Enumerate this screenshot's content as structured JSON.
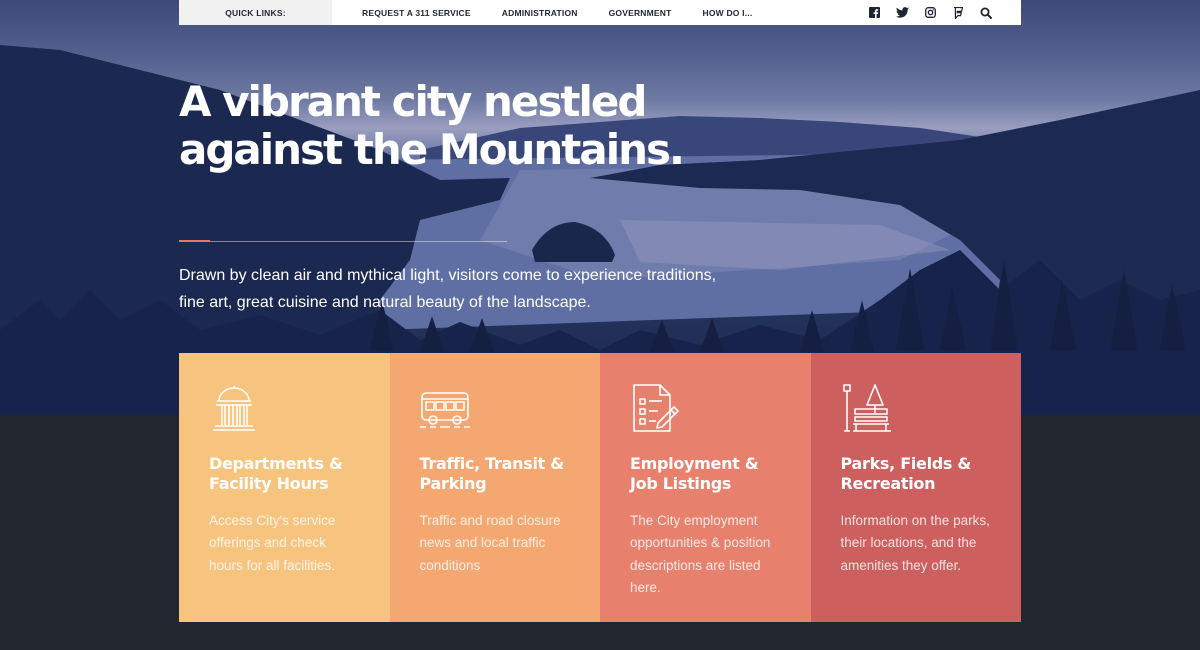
{
  "nav": {
    "quick_links_label": "QUICK LINKS:",
    "links": [
      "REQUEST A 311 SERVICE",
      "ADMINISTRATION",
      "GOVERNMENT",
      "HOW DO I..."
    ],
    "social_icons": [
      "facebook-icon",
      "twitter-icon",
      "instagram-icon",
      "foursquare-icon",
      "search-icon"
    ]
  },
  "hero": {
    "headline": "A vibrant city nestled against the Mountains.",
    "intro": "Drawn by clean air and mythical light, visitors come to experience traditions, fine art, great cuisine and natural beauty of the landscape.",
    "accent_color": "#e9765e"
  },
  "cards": [
    {
      "icon": "courthouse-icon",
      "title": "Departments & Facility Hours",
      "description": "Access City's service offerings and check hours for all facilities.",
      "color": "#f7c47f"
    },
    {
      "icon": "bus-icon",
      "title": "Traffic, Transit & Parking",
      "description": "Traffic and road closure news and local traffic conditions",
      "color": "#f4a770"
    },
    {
      "icon": "document-icon",
      "title": "Employment & Job Listings",
      "description": "The City employment opportunities & position descriptions are listed here.",
      "color": "#e8806e"
    },
    {
      "icon": "park-bench-icon",
      "title": "Parks, Fields & Recreation",
      "description": "Information on the parks, their locations, and the amenities they offer.",
      "color": "#cd5f5f"
    }
  ],
  "colors": {
    "footer_dark": "#22272f",
    "nav_text": "#1f2533"
  }
}
